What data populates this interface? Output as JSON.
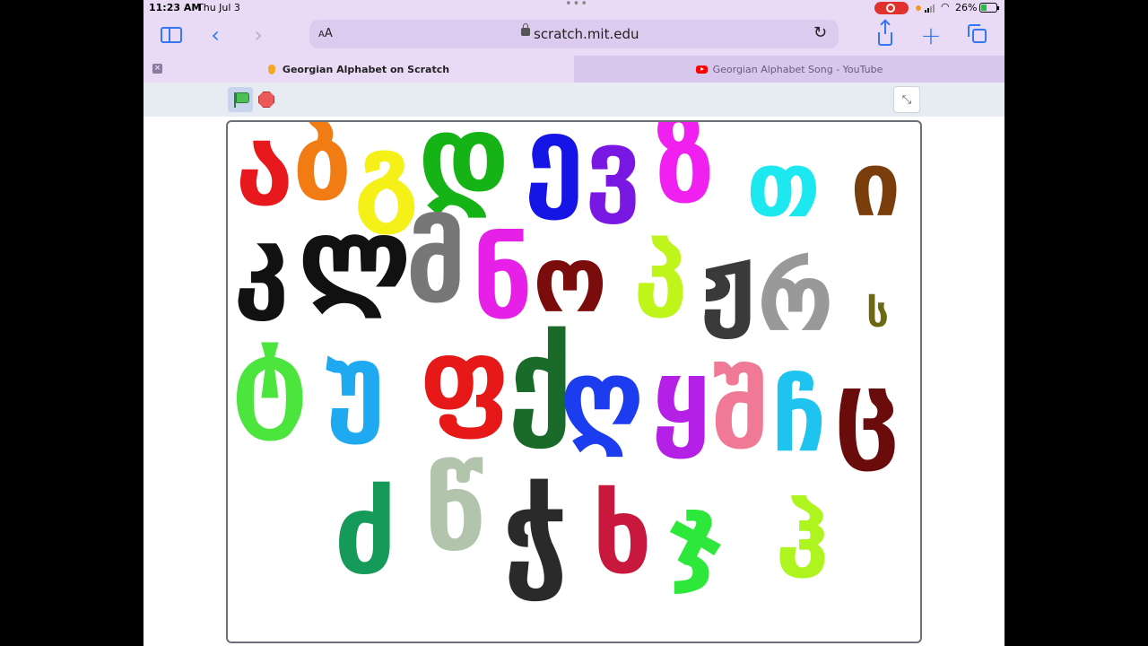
{
  "status_bar": {
    "time": "11:23 AM",
    "date": "Thu Jul 3",
    "battery": "26%"
  },
  "toolbar": {
    "text_size_label": "AA",
    "url": "scratch.mit.edu"
  },
  "tabs": [
    {
      "title": "Georgian Alphabet on Scratch",
      "active": true
    },
    {
      "title": "Georgian Alphabet Song - YouTube",
      "active": false
    }
  ],
  "stage": {
    "letters": [
      {
        "char": "ა",
        "color": "#e8191c"
      },
      {
        "char": "ბ",
        "color": "#f07c13"
      },
      {
        "char": "გ",
        "color": "#f4f018"
      },
      {
        "char": "დ",
        "color": "#15b315"
      },
      {
        "char": "ე",
        "color": "#1515e6"
      },
      {
        "char": "ვ",
        "color": "#7a18e3"
      },
      {
        "char": "ზ",
        "color": "#f020f0"
      },
      {
        "char": "თ",
        "color": "#1de8f0"
      },
      {
        "char": "ი",
        "color": "#7a3e0c"
      },
      {
        "char": "კ",
        "color": "#111111"
      },
      {
        "char": "ლ",
        "color": "#111111"
      },
      {
        "char": "მ",
        "color": "#777777"
      },
      {
        "char": "ნ",
        "color": "#e620e6"
      },
      {
        "char": "ო",
        "color": "#7a0c0c"
      },
      {
        "char": "პ",
        "color": "#bff51a"
      },
      {
        "char": "ჟ",
        "color": "#3a3a3a"
      },
      {
        "char": "რ",
        "color": "#999999"
      },
      {
        "char": "ს",
        "color": "#6b6a13"
      },
      {
        "char": "ტ",
        "color": "#4be53e"
      },
      {
        "char": "უ",
        "color": "#1ea9f0"
      },
      {
        "char": "ფ",
        "color": "#e61818"
      },
      {
        "char": "ქ",
        "color": "#1a6b2a"
      },
      {
        "char": "ღ",
        "color": "#1c3cf0"
      },
      {
        "char": "ყ",
        "color": "#b520e6"
      },
      {
        "char": "შ",
        "color": "#f07a96"
      },
      {
        "char": "ჩ",
        "color": "#1ec3f0"
      },
      {
        "char": "ც",
        "color": "#6b0c0c"
      },
      {
        "char": "ძ",
        "color": "#169a5a"
      },
      {
        "char": "წ",
        "color": "#b3c4ac"
      },
      {
        "char": "ჭ",
        "color": "#2a2a2a"
      },
      {
        "char": "ხ",
        "color": "#c8183e"
      },
      {
        "char": "ჯ",
        "color": "#2de83a"
      },
      {
        "char": "ჰ",
        "color": "#aef520"
      }
    ]
  }
}
